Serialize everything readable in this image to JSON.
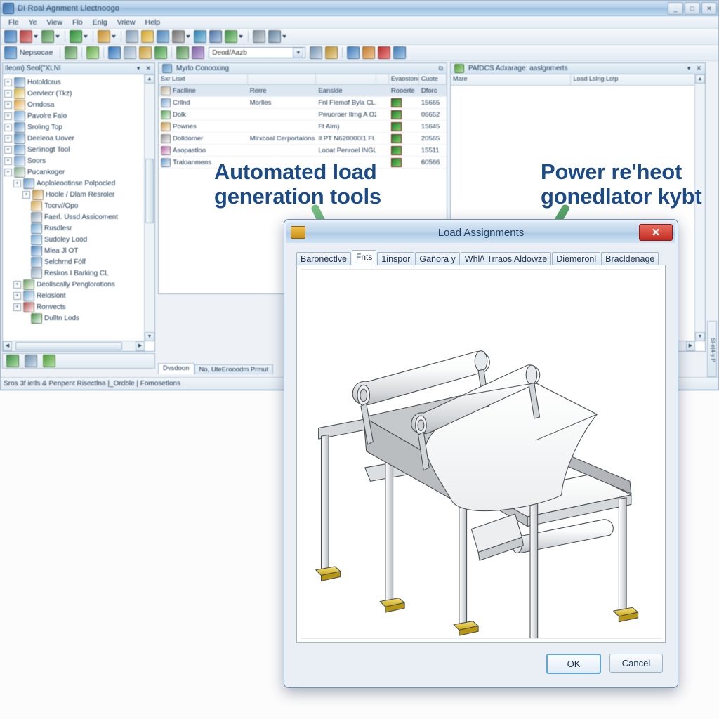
{
  "app": {
    "title": "DI Roal Agnment Llectnoogo",
    "window_buttons": [
      "_",
      "□",
      "✕"
    ],
    "menu": [
      "Fle",
      "Ye",
      "View",
      "Flo",
      "Enlg",
      "Vriew",
      "Help"
    ],
    "toolbar_label": "Nepsocae",
    "toolbar_combo_value": "Deod/Aazb",
    "toolbar_combo_placeholder": "Deod/Aazb",
    "status_text": "Sros 3f ietls & Penpent Risectlna |_Ordble | Fomosetlons"
  },
  "left_panel": {
    "header": "Ileom) Seol(\"XLNI",
    "close_label": "✕",
    "menu_label": "▾",
    "tree": [
      {
        "label": "Hotoldcrus",
        "indent": 0,
        "expander": "+",
        "color": "#5b8fbe"
      },
      {
        "label": "Oervlecr (Tkz)",
        "indent": 0,
        "expander": "+",
        "color": "#d8b23a"
      },
      {
        "label": "Orndosa",
        "indent": 0,
        "expander": "+",
        "color": "#e0a33c"
      },
      {
        "label": "Pavolre Falo",
        "indent": 0,
        "expander": "+",
        "color": "#6aa3d4"
      },
      {
        "label": "Sroling Top",
        "indent": 0,
        "expander": "+",
        "color": "#4d87bb"
      },
      {
        "label": "Deeleoa Uover",
        "indent": 0,
        "expander": "+",
        "color": "#4f8cbf"
      },
      {
        "label": "Serlinogt Tool",
        "indent": 0,
        "expander": "+",
        "color": "#5a93c4"
      },
      {
        "label": "Soors",
        "indent": 0,
        "expander": "+",
        "color": "#6c9fcd"
      },
      {
        "label": "Pucankoger",
        "indent": 0,
        "expander": "+",
        "color": "#7fae8a"
      },
      {
        "label": "Aoploleootinse Polpocled",
        "indent": 1,
        "expander": "+",
        "color": "#5f98c8"
      },
      {
        "label": "Hoole / Dlam Resroler",
        "indent": 2,
        "expander": "+",
        "color": "#c7963c"
      },
      {
        "label": "Tocrv//Opo",
        "indent": 2,
        "expander": "",
        "color": "#d4a84a"
      },
      {
        "label": "Faerl. Ussd Assicoment",
        "indent": 2,
        "expander": "",
        "color": "#7e98ad"
      },
      {
        "label": "Rusdlesr",
        "indent": 2,
        "expander": "",
        "color": "#5f9fd0"
      },
      {
        "label": "Sudoley Lood",
        "indent": 2,
        "expander": "",
        "color": "#6aa6d4"
      },
      {
        "label": "Mlea Jl OT",
        "indent": 2,
        "expander": "",
        "color": "#3f7fc0"
      },
      {
        "label": "Selchrnd Fólf",
        "indent": 2,
        "expander": "",
        "color": "#5d96c6"
      },
      {
        "label": "Reslros I Barking CL",
        "indent": 2,
        "expander": "",
        "color": "#89a6bd"
      },
      {
        "label": "Deollscally Penglorotlons",
        "indent": 1,
        "expander": "+",
        "color": "#66a05f"
      },
      {
        "label": "Reloslont",
        "indent": 1,
        "expander": "+",
        "color": "#6aa3d0"
      },
      {
        "label": "Ronvects",
        "indent": 1,
        "expander": "+",
        "color": "#b04a4a"
      },
      {
        "label": "Dulltn Lods",
        "indent": 2,
        "expander": "",
        "color": "#3f8f3f"
      }
    ]
  },
  "center_panel": {
    "header": "Myrlo Conooxing",
    "restore_label": "⧉",
    "columns": [
      "Sxr Lisxt",
      "",
      "",
      "",
      "Evaostonc",
      "Cuote"
    ],
    "rows": [
      {
        "cells": [
          "Faclline",
          "Rerre",
          "Eanslde",
          "",
          "Rooerte",
          "Dforc"
        ],
        "selected": true,
        "icon": "#b4a88e",
        "chip": false
      },
      {
        "cells": [
          "Crllnd",
          "Morlles",
          "Fnl Flemof Byla CL.",
          "",
          "",
          "15665"
        ],
        "selected": false,
        "icon": "#6d9ed1",
        "chip": true
      },
      {
        "cells": [
          "Dolk",
          "",
          "Pwuoroer Ilrng A O2.",
          "",
          "",
          "06652"
        ],
        "selected": false,
        "icon": "#49a04a",
        "chip": true
      },
      {
        "cells": [
          "Pownes",
          "",
          "Ft Alm)",
          "",
          "",
          "15645"
        ],
        "selected": false,
        "icon": "#c8963c",
        "chip": true
      },
      {
        "cells": [
          "Dolldomer",
          "Mlrxcoal Cerportalons",
          "Il PT N620000I1 Fl..",
          "",
          "",
          "20565"
        ],
        "selected": false,
        "icon": "#8d8d8d",
        "chip": true
      },
      {
        "cells": [
          "Asopastloo",
          "",
          "Looat Penroel lNGL...",
          "",
          "",
          "15511"
        ],
        "selected": false,
        "icon": "#b05ea0",
        "chip": true
      },
      {
        "cells": [
          "Traloanmens",
          "",
          "",
          "",
          "",
          "60566"
        ],
        "selected": false,
        "icon": "#5a8ec0",
        "chip": true
      }
    ]
  },
  "right_panel": {
    "header": "PAfDCS Adxarage: aaslgnmerts",
    "pin_label": "▾",
    "close_label": "✕",
    "columns": [
      "Mare",
      "Load Lslng Lotp"
    ],
    "vertical_tabs": "Sl-e|4-y P"
  },
  "doc_tabs": [
    {
      "label": "Dvsdoon",
      "active": true
    },
    {
      "label": "No, UteErooodm Prmut",
      "active": false
    }
  ],
  "annotations": {
    "left_line1": "Automated load",
    "left_line2": "generation tools",
    "right_line1": "Power re'heot",
    "right_line2": "gonedlator kybt",
    "arrow_color": "#4c9c59",
    "text_color": "#1b4a86"
  },
  "dialog": {
    "title": "Load Assignments",
    "close_label": "✕",
    "tabs": [
      {
        "label": "Baronectlve",
        "active": false
      },
      {
        "label": "Fnts",
        "active": true
      },
      {
        "label": "1inspor",
        "active": false
      },
      {
        "label": "Gañora y",
        "active": false
      },
      {
        "label": "Whl/\\ Trraos Aldowze",
        "active": false
      },
      {
        "label": "Diemeronl",
        "active": false
      },
      {
        "label": "Bracldenage",
        "active": false
      }
    ],
    "ok_label": "OK",
    "cancel_label": "Cancel",
    "illustration": "cad-machine-rollers-conveyor"
  }
}
